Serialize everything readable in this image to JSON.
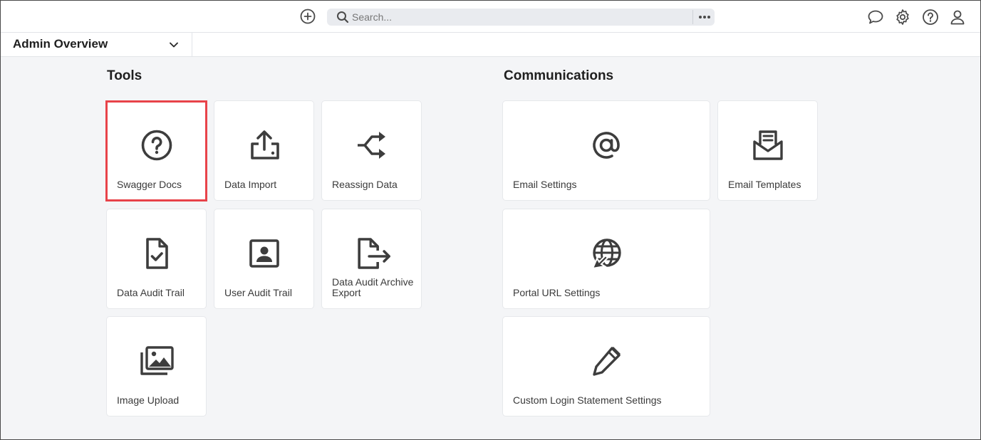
{
  "topbar": {
    "search_placeholder": "Search...",
    "icons": [
      "add-circle-icon",
      "search-icon",
      "more-dots-icon",
      "chat-icon",
      "gear-icon",
      "help-icon",
      "user-icon"
    ]
  },
  "subheader": {
    "dashboard_title": "Admin Overview"
  },
  "tools": {
    "title": "Tools",
    "tiles": [
      {
        "label": "Swagger Docs",
        "icon": "question-circle-icon"
      },
      {
        "label": "Data Import",
        "icon": "upload-icon"
      },
      {
        "label": "Reassign Data",
        "icon": "reassign-arrows-icon"
      },
      {
        "label": "Data Audit Trail",
        "icon": "file-check-icon"
      },
      {
        "label": "User Audit Trail",
        "icon": "user-card-icon"
      },
      {
        "label": "Data Audit Archive Export",
        "icon": "file-export-icon"
      },
      {
        "label": "Image Upload",
        "icon": "images-icon"
      }
    ]
  },
  "communications": {
    "title": "Communications",
    "tiles": [
      {
        "label": "Email Settings",
        "icon": "at-sign-icon"
      },
      {
        "label": "Email Templates",
        "icon": "envelope-open-icon"
      },
      {
        "label": "Portal URL Settings",
        "icon": "globe-pointer-icon"
      },
      {
        "label": "Custom Login Statement Settings",
        "icon": "pen-icon"
      }
    ]
  },
  "colors": {
    "highlight": "#e8434a",
    "icon": "#3d3d3d",
    "background": "#f4f5f7"
  }
}
